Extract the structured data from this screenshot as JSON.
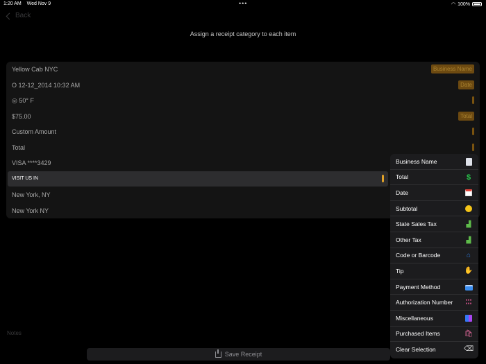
{
  "status_bar": {
    "time": "1:20 AM",
    "date": "Wed Nov 9",
    "battery": "100%"
  },
  "nav": {
    "back_label": "Back"
  },
  "instruction": "Assign a receipt category to each item",
  "items": [
    {
      "text": "Yellow Cab NYC",
      "badge": "Business Name"
    },
    {
      "text": "O 12-12_2014 10:32 AM",
      "badge": "Date"
    },
    {
      "text": "◎ 50° F",
      "badge": ""
    },
    {
      "text": "$75.00",
      "badge": "Total"
    },
    {
      "text": "Custom Amount",
      "badge": ""
    },
    {
      "text": "Total",
      "badge": ""
    },
    {
      "text": "VISA ****3429",
      "badge": ""
    },
    {
      "text": "VISIT US IN",
      "badge": ""
    },
    {
      "text": "New York, NY",
      "badge": ""
    },
    {
      "text": "New York NY",
      "badge": ""
    }
  ],
  "category_menu": [
    {
      "label": "Business Name",
      "icon": "building-icon"
    },
    {
      "label": "Total",
      "icon": "dollar-icon"
    },
    {
      "label": "Date",
      "icon": "calendar-icon"
    },
    {
      "label": "Subtotal",
      "icon": "coin-icon"
    },
    {
      "label": "State Sales Tax",
      "icon": "chart-icon"
    },
    {
      "label": "Other Tax",
      "icon": "chart-icon"
    },
    {
      "label": "Code or Barcode",
      "icon": "house-icon"
    },
    {
      "label": "Tip",
      "icon": "hand-money-icon"
    },
    {
      "label": "Payment Method",
      "icon": "credit-card-icon"
    },
    {
      "label": "Authorization Number",
      "icon": "digits-icon"
    },
    {
      "label": "Miscellaneous",
      "icon": "shapes-icon"
    },
    {
      "label": "Purchased Items",
      "icon": "shopping-bags-icon"
    },
    {
      "label": "Clear Selection",
      "icon": "delete-backspace-icon"
    }
  ],
  "notes_placeholder": "Notes",
  "save_label": "Save Receipt",
  "colors": {
    "badge_bg": "#6d4a11",
    "badge_text": "#a9822f",
    "marker_active": "#e1a228",
    "menu_bg": "#1c1c1e"
  }
}
